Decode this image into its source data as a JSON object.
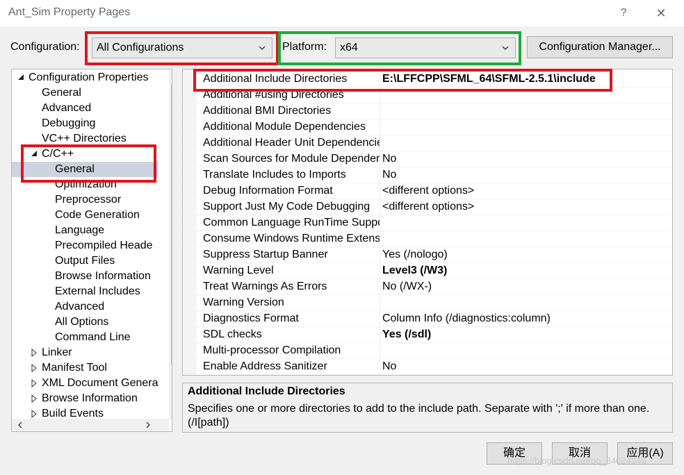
{
  "window": {
    "title": "Ant_Sim Property Pages",
    "help_glyph": "?",
    "close_glyph": "✕"
  },
  "toolbar": {
    "configuration_label": "Configuration:",
    "configuration_value": "All Configurations",
    "platform_label": "Platform:",
    "platform_value": "x64",
    "config_manager_label": "Configuration Manager..."
  },
  "tree": {
    "items": [
      {
        "label": "Configuration Properties",
        "indent": 0,
        "expander": "expanded"
      },
      {
        "label": "General",
        "indent": 1,
        "expander": "none"
      },
      {
        "label": "Advanced",
        "indent": 1,
        "expander": "none"
      },
      {
        "label": "Debugging",
        "indent": 1,
        "expander": "none"
      },
      {
        "label": "VC++ Directories",
        "indent": 1,
        "expander": "none"
      },
      {
        "label": "C/C++",
        "indent": 1,
        "expander": "expanded"
      },
      {
        "label": "General",
        "indent": 2,
        "expander": "none",
        "selected": true
      },
      {
        "label": "Optimization",
        "indent": 2,
        "expander": "none"
      },
      {
        "label": "Preprocessor",
        "indent": 2,
        "expander": "none"
      },
      {
        "label": "Code Generation",
        "indent": 2,
        "expander": "none"
      },
      {
        "label": "Language",
        "indent": 2,
        "expander": "none"
      },
      {
        "label": "Precompiled Heade",
        "indent": 2,
        "expander": "none"
      },
      {
        "label": "Output Files",
        "indent": 2,
        "expander": "none"
      },
      {
        "label": "Browse Information",
        "indent": 2,
        "expander": "none"
      },
      {
        "label": "External Includes",
        "indent": 2,
        "expander": "none"
      },
      {
        "label": "Advanced",
        "indent": 2,
        "expander": "none"
      },
      {
        "label": "All Options",
        "indent": 2,
        "expander": "none"
      },
      {
        "label": "Command Line",
        "indent": 2,
        "expander": "none"
      },
      {
        "label": "Linker",
        "indent": 1,
        "expander": "collapsed"
      },
      {
        "label": "Manifest Tool",
        "indent": 1,
        "expander": "collapsed"
      },
      {
        "label": "XML Document Genera",
        "indent": 1,
        "expander": "collapsed"
      },
      {
        "label": "Browse Information",
        "indent": 1,
        "expander": "collapsed"
      },
      {
        "label": "Build Events",
        "indent": 1,
        "expander": "collapsed"
      }
    ]
  },
  "properties": [
    {
      "name": "Additional Include Directories",
      "value": "E:\\LFFCPP\\SFML_64\\SFML-2.5.1\\include",
      "bold": true
    },
    {
      "name": "Additional #using Directories",
      "value": "",
      "bold": false
    },
    {
      "name": "Additional BMI Directories",
      "value": "",
      "bold": false
    },
    {
      "name": "Additional Module Dependencies",
      "value": "",
      "bold": false
    },
    {
      "name": "Additional Header Unit Dependencies",
      "value": "",
      "bold": false
    },
    {
      "name": "Scan Sources for Module Dependencies",
      "value": "No",
      "bold": false
    },
    {
      "name": "Translate Includes to Imports",
      "value": "No",
      "bold": false
    },
    {
      "name": "Debug Information Format",
      "value": "<different options>",
      "bold": false
    },
    {
      "name": "Support Just My Code Debugging",
      "value": "<different options>",
      "bold": false
    },
    {
      "name": "Common Language RunTime Support",
      "value": "",
      "bold": false
    },
    {
      "name": "Consume Windows Runtime Extension",
      "value": "",
      "bold": false
    },
    {
      "name": "Suppress Startup Banner",
      "value": "Yes (/nologo)",
      "bold": false
    },
    {
      "name": "Warning Level",
      "value": "Level3 (/W3)",
      "bold": true
    },
    {
      "name": "Treat Warnings As Errors",
      "value": "No (/WX-)",
      "bold": false
    },
    {
      "name": "Warning Version",
      "value": "",
      "bold": false
    },
    {
      "name": "Diagnostics Format",
      "value": "Column Info (/diagnostics:column)",
      "bold": false
    },
    {
      "name": "SDL checks",
      "value": "Yes (/sdl)",
      "bold": true
    },
    {
      "name": "Multi-processor Compilation",
      "value": "",
      "bold": false
    },
    {
      "name": "Enable Address Sanitizer",
      "value": "No",
      "bold": false
    }
  ],
  "description": {
    "title": "Additional Include Directories",
    "text": "Specifies one or more directories to add to the include path. Separate with ';' if more than one.     (/I[path])"
  },
  "buttons": {
    "ok": "确定",
    "cancel": "取消",
    "apply": "应用(A)"
  },
  "watermark": "https://blog.csdn.net/qq_34024346",
  "colors": {
    "highlight_red": "#e1141e",
    "highlight_green": "#1faa3a",
    "selection": "#cdd3df"
  }
}
